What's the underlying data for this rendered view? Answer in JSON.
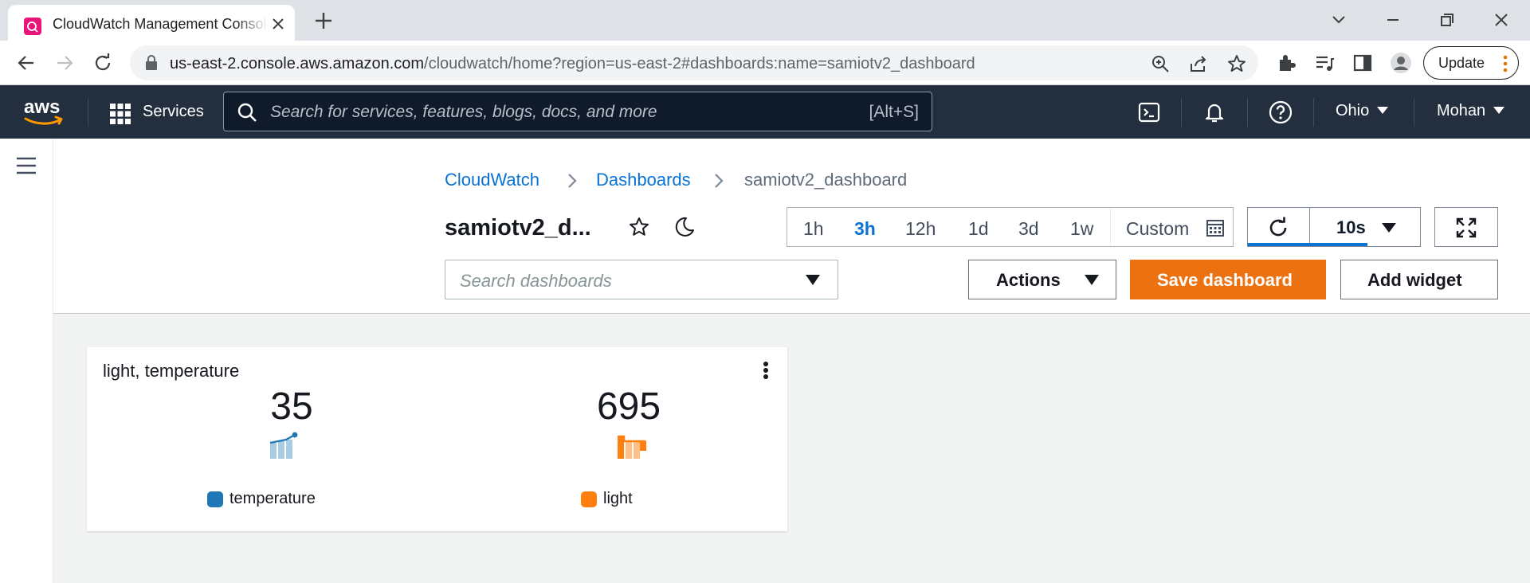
{
  "browser": {
    "tab_title": "CloudWatch Management Console",
    "url_host": "us-east-2.console.aws.amazon.com",
    "url_rest": "/cloudwatch/home?region=us-east-2#dashboards:name=samiotv2_dashboard",
    "update_label": "Update"
  },
  "aws_nav": {
    "services_label": "Services",
    "search_placeholder": "Search for services, features, blogs, docs, and more",
    "search_shortcut": "[Alt+S]",
    "region": "Ohio",
    "user": "Mohan"
  },
  "breadcrumb": {
    "items": [
      "CloudWatch",
      "Dashboards"
    ],
    "current": "samiotv2_dashboard"
  },
  "dashboard": {
    "title": "samiotv2_d...",
    "time_ranges": [
      "1h",
      "3h",
      "12h",
      "1d",
      "3d",
      "1w",
      "Custom"
    ],
    "active_time_range": "3h",
    "refresh_interval": "10s",
    "search_placeholder": "Search dashboards",
    "actions_label": "Actions",
    "save_label": "Save dashboard",
    "add_widget_label": "Add widget"
  },
  "widget": {
    "title": "light, temperature",
    "metrics": [
      {
        "label": "temperature",
        "value": "35",
        "color": "#1f77b4"
      },
      {
        "label": "light",
        "value": "695",
        "color": "#ff7f0e"
      }
    ]
  },
  "colors": {
    "aws_nav_bg": "#232f3e",
    "primary_button": "#ec7211",
    "link": "#0972d3"
  }
}
